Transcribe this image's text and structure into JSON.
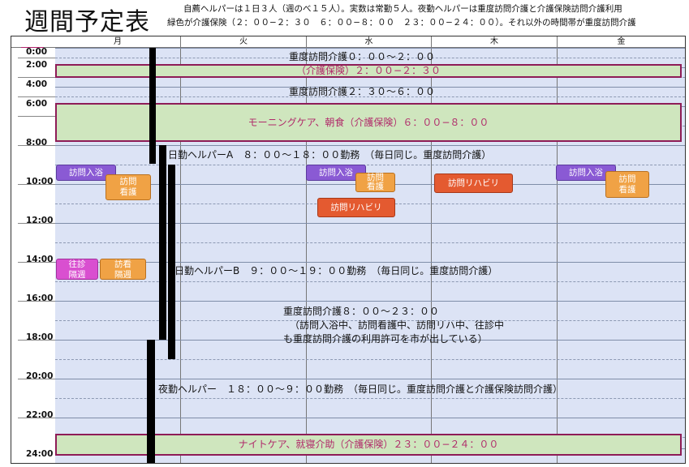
{
  "header": {
    "title": "週間予定表",
    "note_line1": "自薦ヘルパーは１日３人（週のべ１５人）。実数は常勤５人。夜勤ヘルパーは重度訪問介護と介護保険訪問介護利用",
    "note_line2": "緑色が介護保険（２：００−２：３０　６：００−８：００　２３：００−２４：００）。それ以外の時間帯が重度訪問介護"
  },
  "days": [
    "月",
    "火",
    "水",
    "木",
    "金"
  ],
  "time_labels": [
    "0:00",
    "2:00",
    "4:00",
    "6:00",
    "8:00",
    "10:00",
    "12:00",
    "14:00",
    "16:00",
    "18:00",
    "20:00",
    "22:00",
    "24:00"
  ],
  "bands": {
    "b1": "（介護保険）２：００−２：３０",
    "b2": "モーニングケア、朝食（介護保険）６：００−８：００",
    "b3": "ナイトケア、就寝介助（介護保険）２３：００−２４：００"
  },
  "texts": {
    "t1": "重度訪問介護０：００〜２：００",
    "t2": "重度訪問介護２：３０〜６：００",
    "t3": "日勤ヘルパーA　８：００〜１８：００勤務　（毎日同じ。重度訪問介護）",
    "t4": "日勤ヘルパーB　９：００〜１９：００勤務　（毎日同じ。重度訪問介護）",
    "t5a": "重度訪問介護８：００〜２３：００",
    "t5b": "（訪問入浴中、訪問看護中、訪問リハ中、往診中",
    "t5c": "も重度訪問介護の利用許可を市が出している）",
    "t6": "夜勤ヘルパー　１８：００〜９：００勤務　（毎日同じ。重度訪問介護と介護保険訪問介護）"
  },
  "chips": {
    "mon_bath": "訪問入浴",
    "mon_nurse1": "訪問",
    "mon_nurse2": "看護",
    "mon_ojin1": "往診",
    "mon_ojin2": "隔週",
    "mon_hokan1": "訪看",
    "mon_hokan2": "隔週",
    "wed_bath": "訪問入浴",
    "wed_nurse1": "訪問",
    "wed_nurse2": "看護",
    "wed_rehab": "訪問リハビリ",
    "thu_rehab": "訪問リハビリ",
    "fri_bath": "訪問入浴",
    "fri_nurse1": "訪問",
    "fri_nurse2": "看護"
  }
}
